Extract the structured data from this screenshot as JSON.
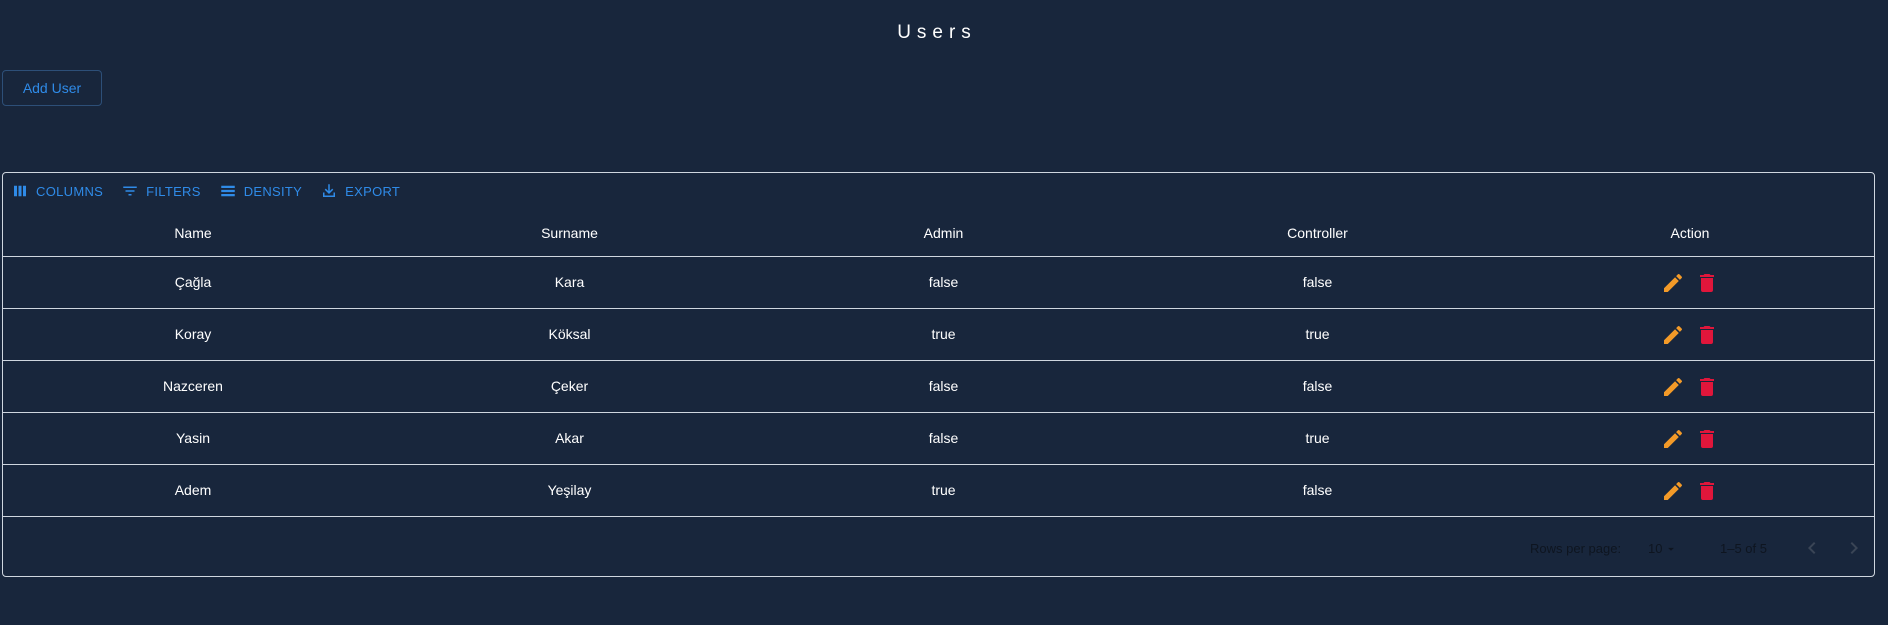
{
  "page": {
    "title": "Users"
  },
  "add_user_label": "Add User",
  "toolbar": {
    "columns_label": "COLUMNS",
    "filters_label": "FILTERS",
    "density_label": "DENSITY",
    "export_label": "EXPORT"
  },
  "table": {
    "headers": [
      "Name",
      "Surname",
      "Admin",
      "Controller",
      "Action"
    ],
    "rows": [
      {
        "name": "Çağla",
        "surname": "Kara",
        "admin": "false",
        "controller": "false"
      },
      {
        "name": "Koray",
        "surname": "Köksal",
        "admin": "true",
        "controller": "true"
      },
      {
        "name": "Nazceren",
        "surname": "Çeker",
        "admin": "false",
        "controller": "false"
      },
      {
        "name": "Yasin",
        "surname": "Akar",
        "admin": "false",
        "controller": "true"
      },
      {
        "name": "Adem",
        "surname": "Yeşilay",
        "admin": "true",
        "controller": "false"
      }
    ],
    "action_icons": [
      "edit-icon",
      "delete-icon"
    ]
  },
  "pagination": {
    "rows_per_page_label": "Rows per page:",
    "rows_per_page_value": "10",
    "range_text": "1–5 of 5"
  },
  "colors": {
    "background": "#18263c",
    "accent": "#2f8be8",
    "edit": "#f39a28",
    "delete": "#e0163b"
  }
}
